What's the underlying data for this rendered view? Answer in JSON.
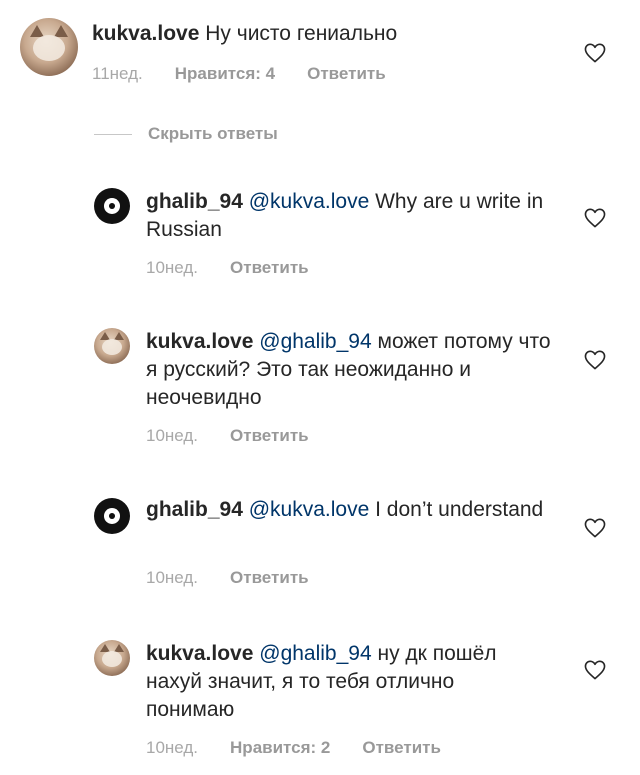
{
  "comments": [
    {
      "username": "kukva.love",
      "mention": "",
      "text": "Ну чисто гениально",
      "time": "11нед.",
      "likes": "Нравится: 4",
      "reply": "Ответить"
    },
    {
      "username": "ghalib_94",
      "mention": "@kukva.love",
      "text": "Why are u write in Russian",
      "time": "10нед.",
      "likes": "",
      "reply": "Ответить"
    },
    {
      "username": "kukva.love",
      "mention": "@ghalib_94",
      "text": "может потому что я русский? Это так неожиданно и неочевидно",
      "time": "10нед.",
      "likes": "",
      "reply": "Ответить"
    },
    {
      "username": "ghalib_94",
      "mention": "@kukva.love",
      "text": "I don’t understand",
      "time": "10нед.",
      "likes": "",
      "reply": "Ответить"
    },
    {
      "username": "kukva.love",
      "mention": "@ghalib_94",
      "text": "ну дк пошёл нахуй значит, я то тебя отлично понимаю",
      "time": "10нед.",
      "likes": "Нравится: 2",
      "reply": "Ответить"
    }
  ],
  "thread": {
    "hide_replies": "Скрыть ответы"
  },
  "icons": {
    "like": "heart-outline-icon",
    "avatar_kukva": "cat-avatar",
    "avatar_ghalib": "ring-avatar"
  },
  "colors": {
    "text": "#262626",
    "mention": "#003569",
    "meta": "#a8a8a8",
    "action": "#999999"
  }
}
